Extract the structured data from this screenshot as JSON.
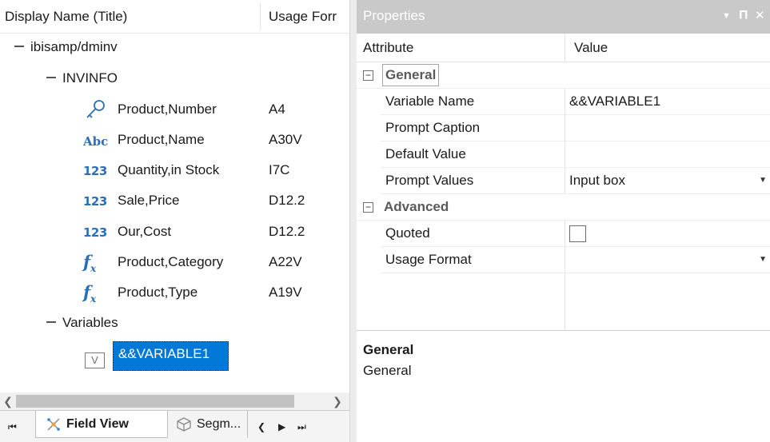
{
  "left_pane": {
    "col_display_name": "Display Name (Title)",
    "col_usage_format": "Usage Forr",
    "tree": {
      "root": "ibisamp/dminv",
      "segment": "INVINFO",
      "fields": [
        {
          "icon": "key-icon",
          "name": "Product,Number",
          "format": "A4"
        },
        {
          "icon": "abc-text-icon",
          "name": "Product,Name",
          "format": "A30V"
        },
        {
          "icon": "numeric-123-icon",
          "name": "Quantity,in Stock",
          "format": "I7C"
        },
        {
          "icon": "numeric-123-icon",
          "name": "Sale,Price",
          "format": "D12.2"
        },
        {
          "icon": "numeric-123-icon",
          "name": "Our,Cost",
          "format": "D12.2"
        },
        {
          "icon": "function-fx-icon",
          "name": "Product,Category",
          "format": "A22V"
        },
        {
          "icon": "function-fx-icon",
          "name": "Product,Type",
          "format": "A19V"
        }
      ],
      "variables_folder": "Variables",
      "variable_badge": "V",
      "variable": "&&VARIABLE1"
    },
    "tabs": {
      "field_view": "Field View",
      "segment_view": "Segm..."
    }
  },
  "properties": {
    "title": "Properties",
    "col_attribute": "Attribute",
    "col_value": "Value",
    "general_category": "General",
    "general_rows": [
      {
        "attribute": "Variable Name",
        "value": "&&VARIABLE1"
      },
      {
        "attribute": "Prompt Caption",
        "value": ""
      },
      {
        "attribute": "Default Value",
        "value": ""
      },
      {
        "attribute": "Prompt Values",
        "value": "Input box"
      }
    ],
    "advanced_category": "Advanced",
    "advanced_rows": [
      {
        "attribute": "Quoted",
        "value": ""
      },
      {
        "attribute": "Usage Format",
        "value": ""
      }
    ],
    "description_title": "General",
    "description_text": "General"
  },
  "colors": {
    "selection": "#0078d7",
    "field_icon": "#2c6fb8",
    "panel_title_bg": "#c9c9c9"
  }
}
